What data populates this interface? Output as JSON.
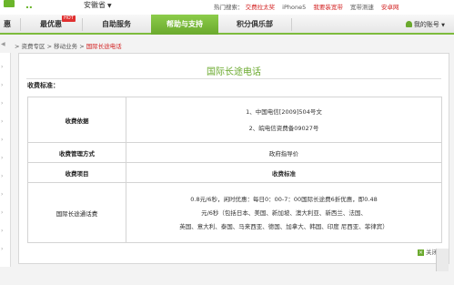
{
  "top": {
    "logo_fragment": "..",
    "province": "安徽省",
    "hot_label": "热门搜索：",
    "hot_items": [
      "交费拉太奖",
      "iPhone5",
      "我要装宽带",
      "宽带测速",
      "安卓网"
    ]
  },
  "nav": {
    "items": [
      "最优惠",
      "自助服务",
      "帮助与支持",
      "积分俱乐部"
    ],
    "partial_first": "惠",
    "badge": "HOT",
    "account": "我的账号"
  },
  "breadcrumb": {
    "path_1": "资费专区",
    "path_2": "移动业务",
    "current": "国际长途电话",
    "separator": ">"
  },
  "panel": {
    "title": "国际长途电话",
    "standard_label": "收费标准：",
    "rows": [
      {
        "head": "收费依据",
        "lines": [
          "1、中国电信[2009]504号文",
          "2、皖电信资费备09027号"
        ]
      },
      {
        "head": "收费管理方式",
        "lines": [
          "政府指导价"
        ]
      },
      {
        "head": "收费项目",
        "lines": [
          "收费标准"
        ]
      },
      {
        "head": "国际长途通话费",
        "lines": [
          "0.8元/6秒，闲时优惠：每日0：00-7：00国际长途费6折优惠，即0.48",
          "元/6秒（包括日本、美国、新加坡、澳大利亚、新西兰、法国、",
          "英国、意大利、泰国、马来西亚、德国、加拿大、韩国、印度 尼西亚、菲律宾）"
        ]
      }
    ],
    "close_label": "关闭"
  }
}
